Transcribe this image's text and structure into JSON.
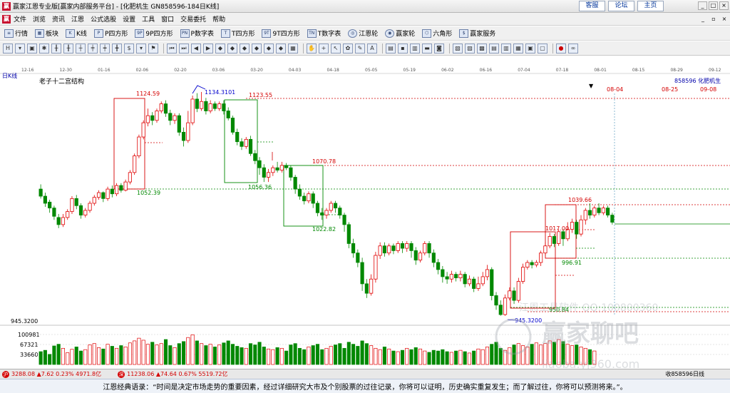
{
  "window": {
    "title": "赢家江恩专业版[赢家内部服务平台] - [化肥机生   GN858596-184日K线]",
    "links": [
      "客服",
      "论坛",
      "主页"
    ]
  },
  "menu": [
    "文件",
    "浏览",
    "资讯",
    "江恩",
    "公式选股",
    "设置",
    "工具",
    "窗口",
    "交易委托",
    "帮助"
  ],
  "toolbar1": [
    {
      "icon": "list-icon",
      "label": "行情"
    },
    {
      "icon": "block-icon",
      "label": "板块"
    },
    {
      "icon": "kline-icon",
      "label": "K线"
    },
    {
      "icon": "p-square-icon",
      "label": "P四方形"
    },
    {
      "icon": "9p-square-icon",
      "label": "9P四方形"
    },
    {
      "icon": "p-number-icon",
      "label": "P数字表"
    },
    {
      "icon": "t-square-icon",
      "label": "T四方形"
    },
    {
      "icon": "9t-square-icon",
      "label": "9T四方形"
    },
    {
      "icon": "t-number-icon",
      "label": "T数字表"
    },
    {
      "icon": "jiangen-wheel-icon",
      "label": "江恩轮"
    },
    {
      "icon": "winner-wheel-icon",
      "label": "赢家轮"
    },
    {
      "icon": "hexagon-icon",
      "label": "六角形"
    },
    {
      "icon": "service-icon",
      "label": "赢家服务"
    }
  ],
  "chart_header": {
    "period_label": "日K线",
    "study_name": "老子十二宫结构",
    "stock_code_name": "858596  化肥机生",
    "future_date_marks": [
      "08-04",
      "08-25",
      "09-08"
    ]
  },
  "date_axis": [
    "12-16",
    "12-30",
    "01-16",
    "02-06",
    "02-20",
    "03-06",
    "03-20",
    "04-03",
    "04-18",
    "05-05",
    "05-19",
    "06-02",
    "06-16",
    "07-04",
    "07-18",
    "08-01",
    "08-15",
    "08-29",
    "09-12"
  ],
  "annotations": {
    "high_124459": "1124.59",
    "peak_11343101": "1134.3101",
    "level_112355": "1123.55",
    "low_105239": "1052.39",
    "level_107078": "1070.78",
    "low_105636": "1056.36",
    "low_102282": "1022.82",
    "level_103966": "1039.66",
    "level_101700": "1017.00",
    "level_99691": "996.91",
    "level_95084": "950.84",
    "low_9453200": "945.3200",
    "low_axis_label": "945.3200"
  },
  "volume_axis": [
    "100981",
    "67321",
    "33660"
  ],
  "watermark": {
    "line1": "江恩工具软件  QQ:100800360",
    "line2": "赢家聊吧",
    "line3": "liaoba.yj360.com"
  },
  "chart_data": {
    "type": "candlestick",
    "price_ylim": [
      940,
      1140
    ],
    "note_colors": {
      "up": "#e00000",
      "down": "#008800"
    },
    "series": [
      {
        "o": 1052,
        "c": 1046,
        "h": 1056,
        "l": 1044
      },
      {
        "o": 1046,
        "c": 1040,
        "h": 1049,
        "l": 1037
      },
      {
        "o": 1041,
        "c": 1036,
        "h": 1043,
        "l": 1032
      },
      {
        "o": 1036,
        "c": 1029,
        "h": 1038,
        "l": 1026
      },
      {
        "o": 1028,
        "c": 1022,
        "h": 1031,
        "l": 1019
      },
      {
        "o": 1022,
        "c": 1028,
        "h": 1031,
        "l": 1020
      },
      {
        "o": 1028,
        "c": 1033,
        "h": 1035,
        "l": 1026
      },
      {
        "o": 1033,
        "c": 1044,
        "h": 1046,
        "l": 1031
      },
      {
        "o": 1044,
        "c": 1038,
        "h": 1047,
        "l": 1035
      },
      {
        "o": 1038,
        "c": 1030,
        "h": 1040,
        "l": 1027
      },
      {
        "o": 1030,
        "c": 1034,
        "h": 1036,
        "l": 1028
      },
      {
        "o": 1034,
        "c": 1040,
        "h": 1042,
        "l": 1032
      },
      {
        "o": 1040,
        "c": 1045,
        "h": 1047,
        "l": 1038
      },
      {
        "o": 1045,
        "c": 1049,
        "h": 1051,
        "l": 1043
      },
      {
        "o": 1049,
        "c": 1044,
        "h": 1050,
        "l": 1041
      },
      {
        "o": 1044,
        "c": 1052,
        "h": 1054,
        "l": 1042
      },
      {
        "o": 1052,
        "c": 1048,
        "h": 1055,
        "l": 1045
      },
      {
        "o": 1048,
        "c": 1055,
        "h": 1057,
        "l": 1046
      },
      {
        "o": 1055,
        "c": 1051,
        "h": 1057,
        "l": 1049
      },
      {
        "o": 1051,
        "c": 1058,
        "h": 1060,
        "l": 1050
      },
      {
        "o": 1058,
        "c": 1066,
        "h": 1068,
        "l": 1056
      },
      {
        "o": 1066,
        "c": 1080,
        "h": 1082,
        "l": 1064
      },
      {
        "o": 1080,
        "c": 1096,
        "h": 1098,
        "l": 1078
      },
      {
        "o": 1096,
        "c": 1108,
        "h": 1110,
        "l": 1094
      },
      {
        "o": 1108,
        "c": 1114,
        "h": 1120,
        "l": 1105
      },
      {
        "o": 1114,
        "c": 1110,
        "h": 1117,
        "l": 1106
      },
      {
        "o": 1110,
        "c": 1118,
        "h": 1120,
        "l": 1108
      },
      {
        "o": 1118,
        "c": 1124,
        "h": 1126,
        "l": 1116
      },
      {
        "o": 1124,
        "c": 1116,
        "h": 1127,
        "l": 1113
      },
      {
        "o": 1116,
        "c": 1110,
        "h": 1119,
        "l": 1106
      },
      {
        "o": 1110,
        "c": 1114,
        "h": 1116,
        "l": 1107
      },
      {
        "o": 1114,
        "c": 1100,
        "h": 1116,
        "l": 1097
      },
      {
        "o": 1100,
        "c": 1093,
        "h": 1104,
        "l": 1088
      },
      {
        "o": 1093,
        "c": 1108,
        "h": 1118,
        "l": 1091
      },
      {
        "o": 1108,
        "c": 1128,
        "h": 1131,
        "l": 1106
      },
      {
        "o": 1128,
        "c": 1120,
        "h": 1133,
        "l": 1117
      },
      {
        "o": 1120,
        "c": 1126,
        "h": 1134,
        "l": 1118
      },
      {
        "o": 1126,
        "c": 1118,
        "h": 1129,
        "l": 1115
      },
      {
        "o": 1118,
        "c": 1124,
        "h": 1127,
        "l": 1116
      },
      {
        "o": 1124,
        "c": 1120,
        "h": 1126,
        "l": 1118
      },
      {
        "o": 1120,
        "c": 1124,
        "h": 1126,
        "l": 1118
      },
      {
        "o": 1124,
        "c": 1118,
        "h": 1127,
        "l": 1115
      },
      {
        "o": 1118,
        "c": 1112,
        "h": 1121,
        "l": 1110
      },
      {
        "o": 1112,
        "c": 1100,
        "h": 1114,
        "l": 1098
      },
      {
        "o": 1100,
        "c": 1092,
        "h": 1103,
        "l": 1089
      },
      {
        "o": 1092,
        "c": 1088,
        "h": 1095,
        "l": 1085
      },
      {
        "o": 1088,
        "c": 1094,
        "h": 1096,
        "l": 1086
      },
      {
        "o": 1094,
        "c": 1082,
        "h": 1097,
        "l": 1080
      },
      {
        "o": 1082,
        "c": 1076,
        "h": 1085,
        "l": 1073
      },
      {
        "o": 1076,
        "c": 1070,
        "h": 1079,
        "l": 1064
      },
      {
        "o": 1070,
        "c": 1062,
        "h": 1073,
        "l": 1058
      },
      {
        "o": 1062,
        "c": 1066,
        "h": 1069,
        "l": 1058
      },
      {
        "o": 1066,
        "c": 1070,
        "h": 1072,
        "l": 1063
      },
      {
        "o": 1070,
        "c": 1068,
        "h": 1075,
        "l": 1066
      },
      {
        "o": 1068,
        "c": 1072,
        "h": 1075,
        "l": 1066
      },
      {
        "o": 1072,
        "c": 1070,
        "h": 1074,
        "l": 1068
      },
      {
        "o": 1070,
        "c": 1062,
        "h": 1072,
        "l": 1059
      },
      {
        "o": 1062,
        "c": 1052,
        "h": 1064,
        "l": 1048
      },
      {
        "o": 1052,
        "c": 1046,
        "h": 1056,
        "l": 1043
      },
      {
        "o": 1046,
        "c": 1042,
        "h": 1049,
        "l": 1039
      },
      {
        "o": 1042,
        "c": 1048,
        "h": 1050,
        "l": 1040
      },
      {
        "o": 1048,
        "c": 1040,
        "h": 1050,
        "l": 1036
      },
      {
        "o": 1040,
        "c": 1032,
        "h": 1042,
        "l": 1029
      },
      {
        "o": 1032,
        "c": 1030,
        "h": 1036,
        "l": 1026
      },
      {
        "o": 1030,
        "c": 1034,
        "h": 1036,
        "l": 1027
      },
      {
        "o": 1034,
        "c": 1040,
        "h": 1042,
        "l": 1032
      },
      {
        "o": 1040,
        "c": 1036,
        "h": 1042,
        "l": 1032
      },
      {
        "o": 1036,
        "c": 1030,
        "h": 1038,
        "l": 1027
      },
      {
        "o": 1030,
        "c": 1022,
        "h": 1032,
        "l": 1016
      },
      {
        "o": 1022,
        "c": 1006,
        "h": 1024,
        "l": 1002
      },
      {
        "o": 1006,
        "c": 998,
        "h": 1010,
        "l": 994
      },
      {
        "o": 998,
        "c": 990,
        "h": 1001,
        "l": 986
      },
      {
        "o": 990,
        "c": 972,
        "h": 994,
        "l": 966
      },
      {
        "o": 972,
        "c": 964,
        "h": 976,
        "l": 960
      },
      {
        "o": 964,
        "c": 976,
        "h": 980,
        "l": 962
      },
      {
        "o": 976,
        "c": 996,
        "h": 999,
        "l": 973
      },
      {
        "o": 996,
        "c": 1004,
        "h": 1007,
        "l": 993
      },
      {
        "o": 1004,
        "c": 998,
        "h": 1007,
        "l": 995
      },
      {
        "o": 998,
        "c": 1004,
        "h": 1006,
        "l": 996
      },
      {
        "o": 1004,
        "c": 1000,
        "h": 1006,
        "l": 997
      },
      {
        "o": 1000,
        "c": 1006,
        "h": 1008,
        "l": 998
      },
      {
        "o": 1006,
        "c": 1002,
        "h": 1008,
        "l": 998
      },
      {
        "o": 1002,
        "c": 1006,
        "h": 1008,
        "l": 999
      },
      {
        "o": 1006,
        "c": 1000,
        "h": 1008,
        "l": 994
      },
      {
        "o": 1000,
        "c": 992,
        "h": 1003,
        "l": 988
      },
      {
        "o": 992,
        "c": 998,
        "h": 1000,
        "l": 990
      },
      {
        "o": 998,
        "c": 1006,
        "h": 1008,
        "l": 996
      },
      {
        "o": 1006,
        "c": 998,
        "h": 1008,
        "l": 994
      },
      {
        "o": 998,
        "c": 990,
        "h": 1001,
        "l": 986
      },
      {
        "o": 990,
        "c": 984,
        "h": 993,
        "l": 980
      },
      {
        "o": 984,
        "c": 978,
        "h": 987,
        "l": 973
      },
      {
        "o": 978,
        "c": 976,
        "h": 982,
        "l": 972
      },
      {
        "o": 976,
        "c": 980,
        "h": 983,
        "l": 973
      },
      {
        "o": 980,
        "c": 977,
        "h": 982,
        "l": 974
      },
      {
        "o": 977,
        "c": 980,
        "h": 983,
        "l": 974
      },
      {
        "o": 980,
        "c": 972,
        "h": 982,
        "l": 969
      },
      {
        "o": 972,
        "c": 976,
        "h": 979,
        "l": 970
      },
      {
        "o": 976,
        "c": 968,
        "h": 978,
        "l": 965
      },
      {
        "o": 968,
        "c": 972,
        "h": 978,
        "l": 966
      },
      {
        "o": 972,
        "c": 978,
        "h": 982,
        "l": 970
      },
      {
        "o": 978,
        "c": 984,
        "h": 988,
        "l": 975
      },
      {
        "o": 984,
        "c": 962,
        "h": 986,
        "l": 958
      },
      {
        "o": 962,
        "c": 954,
        "h": 965,
        "l": 950
      },
      {
        "o": 954,
        "c": 946,
        "h": 958,
        "l": 945
      },
      {
        "o": 946,
        "c": 960,
        "h": 963,
        "l": 945
      },
      {
        "o": 960,
        "c": 966,
        "h": 969,
        "l": 958
      },
      {
        "o": 966,
        "c": 958,
        "h": 969,
        "l": 955
      },
      {
        "o": 958,
        "c": 974,
        "h": 977,
        "l": 956
      },
      {
        "o": 974,
        "c": 986,
        "h": 989,
        "l": 972
      },
      {
        "o": 986,
        "c": 990,
        "h": 992,
        "l": 984
      },
      {
        "o": 990,
        "c": 988,
        "h": 992,
        "l": 985
      },
      {
        "o": 988,
        "c": 990,
        "h": 992,
        "l": 986
      },
      {
        "o": 990,
        "c": 998,
        "h": 1000,
        "l": 987
      },
      {
        "o": 998,
        "c": 1004,
        "h": 1007,
        "l": 996
      },
      {
        "o": 1004,
        "c": 1012,
        "h": 1015,
        "l": 1002
      },
      {
        "o": 1012,
        "c": 1006,
        "h": 1014,
        "l": 1003
      },
      {
        "o": 1006,
        "c": 1016,
        "h": 1018,
        "l": 1004
      },
      {
        "o": 1016,
        "c": 1010,
        "h": 1018,
        "l": 1004
      },
      {
        "o": 1010,
        "c": 1018,
        "h": 1024,
        "l": 1008
      },
      {
        "o": 1018,
        "c": 1024,
        "h": 1027,
        "l": 1015
      },
      {
        "o": 1024,
        "c": 1014,
        "h": 1026,
        "l": 1010
      },
      {
        "o": 1014,
        "c": 1026,
        "h": 1030,
        "l": 1012
      },
      {
        "o": 1026,
        "c": 1034,
        "h": 1036,
        "l": 1022
      },
      {
        "o": 1034,
        "c": 1030,
        "h": 1040,
        "l": 1027
      },
      {
        "o": 1030,
        "c": 1036,
        "h": 1038,
        "l": 1028
      },
      {
        "o": 1036,
        "c": 1032,
        "h": 1040,
        "l": 1030
      },
      {
        "o": 1032,
        "c": 1036,
        "h": 1038,
        "l": 1030
      },
      {
        "o": 1036,
        "c": 1030,
        "h": 1038,
        "l": 1028
      },
      {
        "o": 1030,
        "c": 1024,
        "h": 1032,
        "l": 1022
      }
    ],
    "volume": [
      38,
      42,
      30,
      55,
      60,
      48,
      35,
      45,
      52,
      40,
      44,
      58,
      62,
      50,
      46,
      60,
      54,
      48,
      56,
      52,
      64,
      70,
      78,
      72,
      60,
      66,
      58,
      62,
      74,
      56,
      50,
      62,
      68,
      80,
      88,
      70,
      62,
      56,
      60,
      52,
      58,
      64,
      70,
      60,
      54,
      50,
      48,
      62,
      58,
      66,
      52,
      46,
      44,
      50,
      48,
      40,
      58,
      62,
      48,
      44,
      52,
      56,
      60,
      44,
      48,
      54,
      58,
      62,
      48,
      66,
      60,
      54,
      70,
      62,
      56,
      48,
      44,
      52,
      46,
      40,
      38,
      42,
      48,
      44,
      50,
      46,
      40,
      36,
      42,
      40,
      44,
      38,
      36,
      40,
      42,
      38,
      34,
      40,
      46,
      44,
      52,
      60,
      66,
      48,
      42,
      50,
      58,
      62,
      56,
      52,
      60,
      64,
      58,
      62,
      70,
      66,
      74,
      68,
      60,
      56,
      58,
      52,
      48,
      44,
      40
    ],
    "volume_ylim": [
      0,
      110000
    ]
  },
  "status": {
    "sh_index": "3288.08",
    "sh_change": "▲7.62",
    "sh_pct": "0.23%",
    "sh_amount": "4971.8亿",
    "sz_index": "11238.06",
    "sz_change": "▲74.64",
    "sz_pct": "0.67%",
    "sz_amount": "5519.72亿",
    "right_text": "收858596日线"
  },
  "quote": "江恩经典语录：“时间是决定市场走势的重要因素，经过详细研究大市及个别股票的过往记录，你将可以证明，历史确实重复发生；而了解过往，你将可以预测将来。”。"
}
